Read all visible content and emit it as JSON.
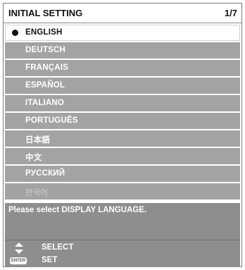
{
  "window": {
    "title": "INITIAL SETTING",
    "page_indicator": "1/7"
  },
  "languages": [
    {
      "label": "ENGLISH",
      "selected": true
    },
    {
      "label": "DEUTSCH"
    },
    {
      "label": "FRANÇAIS"
    },
    {
      "label": "ESPAÑOL"
    },
    {
      "label": "ITALIANO"
    },
    {
      "label": "PORTUGUÊS"
    },
    {
      "label": "日本語"
    },
    {
      "label": "中文"
    },
    {
      "label": "РУССКИЙ"
    },
    {
      "label": "한국어",
      "dimmed": true
    }
  ],
  "message": "Please select DISPLAY LANGUAGE.",
  "footer": {
    "select_label": "SELECT",
    "set_label": "SET",
    "enter_key_label": "ENTER"
  },
  "colors": {
    "item_bg": "#a3a3a3",
    "panel_bg": "#8e8e8e",
    "selected_bg": "#ffffff"
  }
}
